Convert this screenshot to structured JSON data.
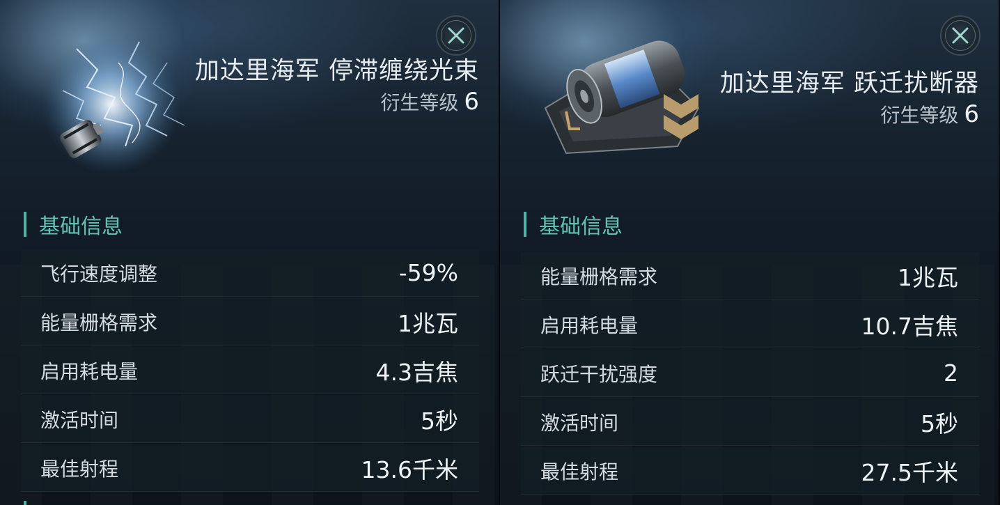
{
  "panels": [
    {
      "name": "加达里海军 停滞缠绕光束",
      "derivation_label": "衍生等级",
      "derivation_value": "6",
      "section_title": "基础信息",
      "icon": "stasis-webifier-icon",
      "stats": [
        {
          "label": "飞行速度调整",
          "value": "-59%"
        },
        {
          "label": "能量栅格需求",
          "value": "1兆瓦"
        },
        {
          "label": "启用耗电量",
          "value": "4.3吉焦"
        },
        {
          "label": "激活时间",
          "value": "5秒"
        },
        {
          "label": "最佳射程",
          "value": "13.6千米"
        }
      ]
    },
    {
      "name": "加达里海军 跃迁扰断器",
      "derivation_label": "衍生等级",
      "derivation_value": "6",
      "section_title": "基础信息",
      "icon": "warp-disruptor-icon",
      "stats": [
        {
          "label": "能量栅格需求",
          "value": "1兆瓦"
        },
        {
          "label": "启用耗电量",
          "value": "10.7吉焦"
        },
        {
          "label": "跃迁干扰强度",
          "value": "2"
        },
        {
          "label": "激活时间",
          "value": "5秒"
        },
        {
          "label": "最佳射程",
          "value": "27.5千米"
        }
      ]
    }
  ],
  "colors": {
    "accent": "#4fb4a8",
    "text": "#e6ecef",
    "row_bg": "#141e26"
  }
}
